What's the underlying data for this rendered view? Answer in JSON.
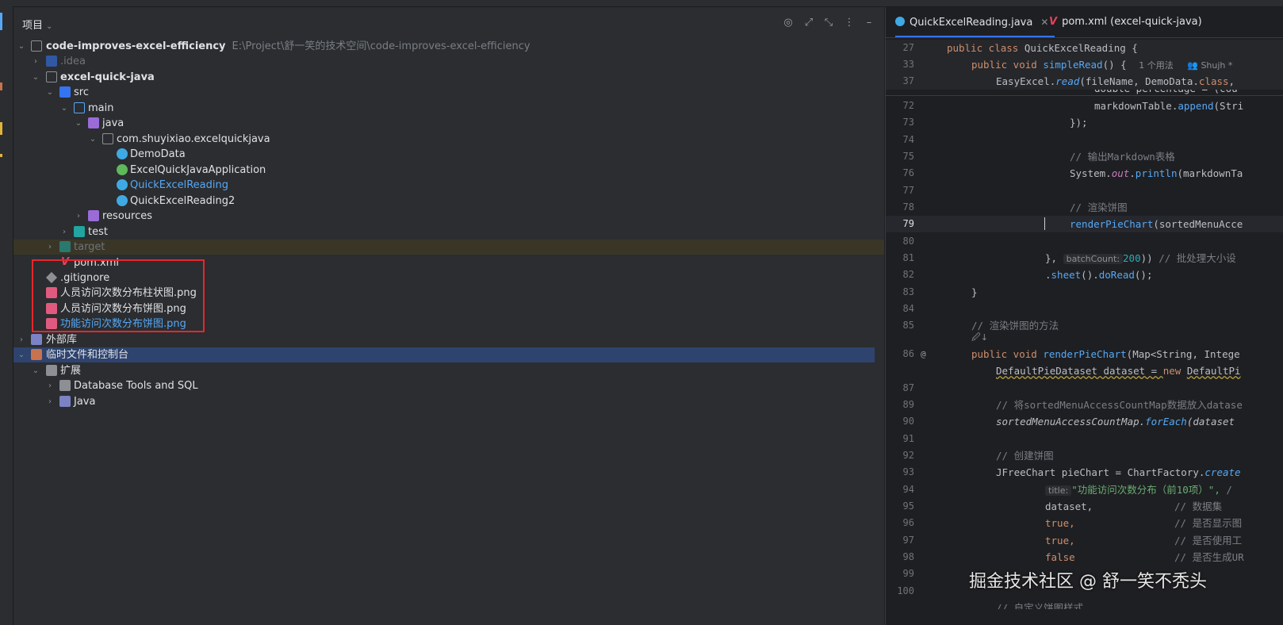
{
  "project_panel": {
    "title": "项目",
    "tools": [
      "target-icon",
      "expand-icon",
      "collapse-icon",
      "more-icon",
      "hide-icon"
    ]
  },
  "tree": [
    {
      "label": "code-improves-excel-efficiency",
      "path": "E:\\Project\\舒一笑的技术空间\\code-improves-excel-efficiency",
      "icon": "folder-icon",
      "level": 0,
      "arrow": "down"
    },
    {
      "label": ".idea",
      "icon": "folder-icon",
      "level": 1,
      "arrow": "right"
    },
    {
      "label": "excel-quick-java",
      "icon": "module-folder-icon",
      "level": 1,
      "arrow": "down"
    },
    {
      "label": "src",
      "icon": "source-folder-icon",
      "level": 2,
      "arrow": "down"
    },
    {
      "label": "main",
      "icon": "folder-icon",
      "level": 3,
      "arrow": "down"
    },
    {
      "label": "java",
      "icon": "java-source-folder-icon",
      "level": 4,
      "arrow": "down"
    },
    {
      "label": "com.shuyixiao.excelquickjava",
      "icon": "package-icon",
      "level": 5,
      "arrow": "down"
    },
    {
      "label": "DemoData",
      "icon": "class-icon",
      "level": 6
    },
    {
      "label": "ExcelQuickJavaApplication",
      "icon": "spring-class-icon",
      "level": 6
    },
    {
      "label": "QuickExcelReading",
      "icon": "class-icon",
      "level": 6
    },
    {
      "label": "QuickExcelReading2",
      "icon": "class-icon",
      "level": 6
    },
    {
      "label": "resources",
      "icon": "resources-folder-icon",
      "level": 4,
      "arrow": "right"
    },
    {
      "label": "test",
      "icon": "test-folder-icon",
      "level": 3,
      "arrow": "right"
    },
    {
      "label": "target",
      "icon": "excluded-folder-icon",
      "level": 2,
      "arrow": "right"
    },
    {
      "label": "pom.xml",
      "icon": "maven-icon",
      "level": 2
    },
    {
      "label": ".gitignore",
      "icon": "git-icon",
      "level": 1
    },
    {
      "label": "人员访问次数分布柱状图.png",
      "icon": "image-icon",
      "level": 1
    },
    {
      "label": "人员访问次数分布饼图.png",
      "icon": "image-icon",
      "level": 1
    },
    {
      "label": "功能访问次数分布饼图.png",
      "icon": "image-icon",
      "level": 1
    },
    {
      "label": "外部库",
      "icon": "library-icon",
      "level": 0,
      "arrow": "right"
    },
    {
      "label": "临时文件和控制台",
      "icon": "scratches-icon",
      "level": 0,
      "arrow": "down"
    },
    {
      "label": "扩展",
      "icon": "folder-icon",
      "level": 1,
      "arrow": "down"
    },
    {
      "label": "Database Tools and SQL",
      "icon": "folder-icon",
      "level": 2,
      "arrow": "right"
    },
    {
      "label": "Java",
      "icon": "java-ext-icon",
      "level": 2,
      "arrow": "right"
    }
  ],
  "editor": {
    "tabs": [
      {
        "label": "QuickExcelReading.java",
        "close": "✕"
      },
      {
        "label": "pom.xml (excel-quick-java)"
      }
    ],
    "sticky": [
      {
        "ln": "27",
        "t1": "public class ",
        "t2": "QuickExcelReading {"
      },
      {
        "ln": "33",
        "t1": "public void ",
        "t2": "simpleRead",
        "t3": "() {",
        "hint1": "1 个用法",
        "hint2": "Shujh *"
      },
      {
        "ln": "37",
        "t1": "EasyExcel.",
        "t2": "read",
        "t3": "(fileName, DemoData.",
        "t4": "class",
        "t5": ","
      }
    ],
    "partial_line": "double percentage = (cou",
    "lines": {
      "l72": {
        "ln": "72",
        "a": "markdownTable.",
        "b": "append",
        "c": "(Stri"
      },
      "l73": {
        "ln": "73",
        "a": "});"
      },
      "l74": {
        "ln": "74"
      },
      "l75": {
        "ln": "75",
        "a": "// 输出Markdown表格"
      },
      "l76": {
        "ln": "76",
        "a": "System.",
        "b": "out",
        "c": ".",
        "d": "println",
        "e": "(markdownTa"
      },
      "l77": {
        "ln": "77"
      },
      "l78": {
        "ln": "78",
        "a": "// 渲染饼图"
      },
      "l79": {
        "ln": "79",
        "a": "renderPieChart",
        "b": "(sortedMenuAcce"
      },
      "l80": {
        "ln": "80"
      },
      "l81": {
        "ln": "81",
        "a": "},",
        "hint": "batchCount:",
        "b": "200",
        "c": ")) ",
        "d": "// 批处理大小设"
      },
      "l82": {
        "ln": "82",
        "a": ".",
        "b": "sheet",
        "c": "().",
        "d": "doRead",
        "e": "();"
      },
      "l83": {
        "ln": "83",
        "a": "}"
      },
      "l84": {
        "ln": "84"
      },
      "l85": {
        "ln": "85",
        "a": "// 渲染饼图的方法"
      },
      "l85b": {
        "a": "🖉↓"
      },
      "l86": {
        "ln": "86",
        "gutter": "@",
        "a": "public void ",
        "b": "renderPieChart",
        "c": "(Map<String, Intege"
      },
      "l87a": {
        "ln": "87",
        "a": "DefaultPieDataset dataset = ",
        "b": "new ",
        "c": "DefaultPi"
      },
      "l87": {
        "ln": "87"
      },
      "l89": {
        "ln": "89",
        "a": "// 将sortedMenuAccessCountMap数据放入datase"
      },
      "l90": {
        "ln": "90",
        "a": "sortedMenuAccessCountMap.",
        "b": "forEach",
        "c": "(dataset"
      },
      "l91": {
        "ln": "91"
      },
      "l92": {
        "ln": "92",
        "a": "// 创建饼图"
      },
      "l93": {
        "ln": "93",
        "a": "JFreeChart pieChart = ChartFactory.",
        "b": "create"
      },
      "l94": {
        "ln": "94",
        "hint": "title:",
        "a": "\"功能访问次数分布（前10项）\",",
        "b": "  /"
      },
      "l95": {
        "ln": "95",
        "a": "dataset,",
        "b": "// 数据集"
      },
      "l96": {
        "ln": "96",
        "a": "true,",
        "b": "// 是否显示图"
      },
      "l97": {
        "ln": "97",
        "a": "true,",
        "b": "// 是否使用工"
      },
      "l98": {
        "ln": "98",
        "a": "false",
        "b": "// 是否生成UR"
      },
      "l99": {
        "ln": "99"
      },
      "l100": {
        "ln": "100"
      },
      "l101": {
        "a": "// 自定义饼图样式"
      }
    }
  },
  "watermark": "掘金技术社区 @ 舒一笑不秃头",
  "colors": {
    "accent": "#3574f0",
    "highlight_box": "#e5282d",
    "selection": "#2e436e"
  }
}
